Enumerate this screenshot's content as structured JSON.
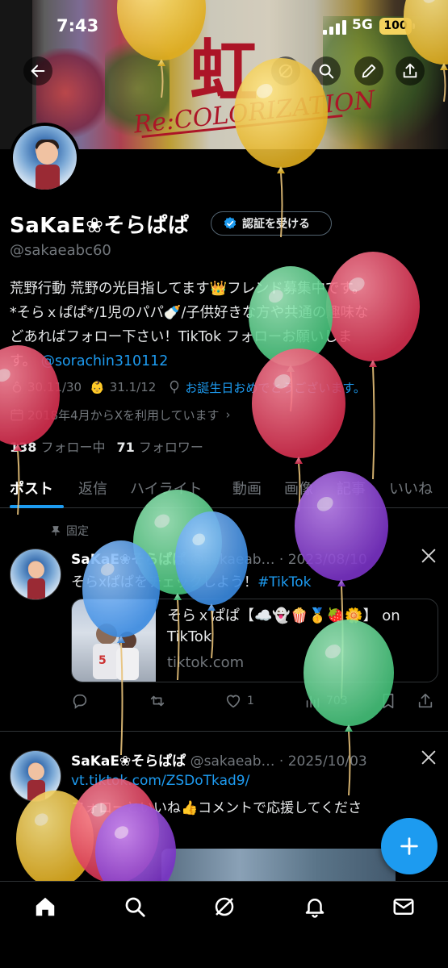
{
  "status_bar": {
    "time": "7:43",
    "network": "5G",
    "battery": "100"
  },
  "banner": {
    "art_text_kanji": "虹",
    "art_text_subtitle": "Re:COLORIZATION"
  },
  "header": {
    "back_icon": "arrow-left-icon",
    "actions": [
      "grok-icon",
      "search-icon",
      "edit-icon",
      "share-icon"
    ]
  },
  "profile": {
    "display_name": "SaKaE❀そらぱぱ",
    "verify_button_label": "認証を受ける",
    "handle": "@sakaeabc60",
    "bio_line1": "荒野行動 荒野の光目指してます👑フレンド募集中です。",
    "bio_line2": "*そらｘぱぱ*/1児のパパ🍼/子供好きな方や共通の趣味な",
    "bio_line3": "どあればフォロー下さい！TikTok フォローお願いしま",
    "bio_line4_prefix": "す。",
    "bio_mention": "@sorachin310112",
    "meta_wedding": "30.11/30",
    "meta_birthday": "31.1/12",
    "meta_location_link": "お誕生日おめでとうございます。",
    "joined": "2018年4月からXを利用しています",
    "following_count": "138",
    "following_label": "フォロー中",
    "followers_count": "71",
    "followers_label": "フォロワー"
  },
  "tabs": [
    "ポスト",
    "返信",
    "ハイライト",
    "動画",
    "画像",
    "記事",
    "いいね"
  ],
  "active_tab": "ポスト",
  "posts": [
    {
      "pinned_label": "固定",
      "name": "SaKaE❀そらぱぱ",
      "handle_date": "@sakaeab… · 2023/08/10",
      "text_prefix": "そらxぱぱをチェックしよう！",
      "hashtag": "#TikTok",
      "card_title": "そらｘぱぱ【☁️👻🍿🥇🍓🌼】 on TikTok",
      "card_domain": "tiktok.com",
      "replies": "",
      "reposts": "",
      "likes": "1",
      "views": "703"
    },
    {
      "name": "SaKaE❀そらぱぱ",
      "handle_date": "@sakaeab… · 2025/10/03",
      "link": "vt.tiktok.com/ZSDoTkad9/",
      "text": "フォローといいね👍コメントで応援してくださ"
    }
  ],
  "fab_icon": "plus-icon",
  "bottom_nav": [
    "home-icon",
    "search-icon",
    "grok-icon",
    "notifications-icon",
    "messages-icon"
  ],
  "colors": {
    "accent": "#1d9bf0",
    "text": "#e7e9ea",
    "muted": "#71767b",
    "background": "#000000",
    "balloon_yellow": "#f2c53d",
    "balloon_red": "#e23c5a",
    "balloon_green": "#5ccf8a",
    "balloon_blue": "#4a9be8",
    "balloon_purple": "#8a3fd1"
  }
}
